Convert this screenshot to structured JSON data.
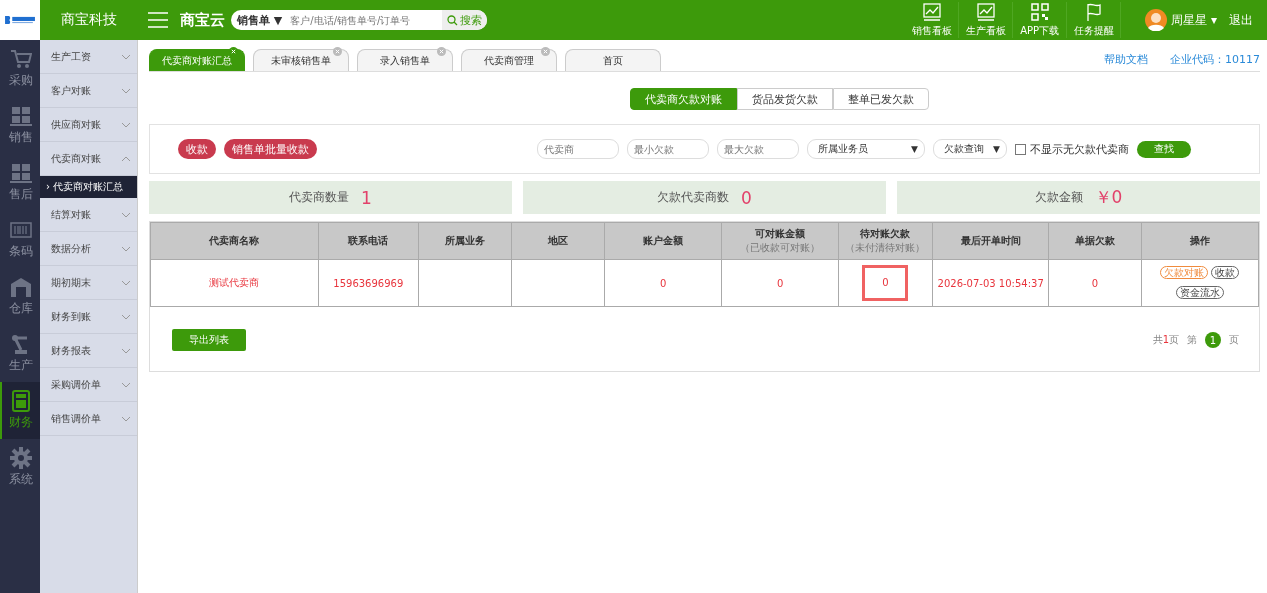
{
  "header": {
    "company": "商宝科技",
    "brand": "商宝云",
    "search": {
      "scope": "销售单 ▼",
      "placeholder": "客户/电话/销售单号/订单号",
      "button": "搜索"
    },
    "tools": [
      {
        "label": "销售看板",
        "kind": "chart"
      },
      {
        "label": "生产看板",
        "kind": "chart"
      },
      {
        "label": "APP下载",
        "kind": "qr"
      },
      {
        "label": "任务提醒",
        "kind": "flag"
      }
    ],
    "user": "周星星 ▾",
    "logout": "退出"
  },
  "rail": [
    {
      "label": "采购",
      "kind": "cart",
      "selected": false
    },
    {
      "label": "销售",
      "kind": "boxes",
      "selected": false
    },
    {
      "label": "售后",
      "kind": "boxes",
      "selected": false
    },
    {
      "label": "条码",
      "kind": "barcode",
      "selected": false
    },
    {
      "label": "仓库",
      "kind": "warehouse",
      "selected": false
    },
    {
      "label": "生产",
      "kind": "robot",
      "selected": false
    },
    {
      "label": "财务",
      "kind": "calculator",
      "selected": true
    },
    {
      "label": "系统",
      "kind": "gear",
      "selected": false
    }
  ],
  "menu": [
    {
      "label": "生产工资",
      "expanded": false
    },
    {
      "label": "客户对账",
      "expanded": false
    },
    {
      "label": "供应商对账",
      "expanded": false
    },
    {
      "label": "代卖商对账",
      "expanded": true,
      "children": [
        {
          "label": "› 代卖商对账汇总",
          "selected": true
        }
      ]
    },
    {
      "label": "结算对账",
      "expanded": false
    },
    {
      "label": "数据分析",
      "expanded": false
    },
    {
      "label": "期初期末",
      "expanded": false
    },
    {
      "label": "财务到账",
      "expanded": false
    },
    {
      "label": "财务报表",
      "expanded": false
    },
    {
      "label": "采购调价单",
      "expanded": false
    },
    {
      "label": "销售调价单",
      "expanded": false
    }
  ],
  "tabs": [
    {
      "label": "代卖商对账汇总",
      "selected": true,
      "closable": true
    },
    {
      "label": "未审核销售单",
      "selected": false,
      "closable": true
    },
    {
      "label": "录入销售单",
      "selected": false,
      "closable": true
    },
    {
      "label": "代卖商管理",
      "selected": false,
      "closable": true
    },
    {
      "label": "首页",
      "selected": false,
      "closable": false
    }
  ],
  "help_link": "帮助文档",
  "company_code": "企业代码：10117",
  "subtabs": [
    {
      "label": "代卖商欠款对账",
      "selected": true
    },
    {
      "label": "货品发货欠款",
      "selected": false
    },
    {
      "label": "整单已发欠款",
      "selected": false
    }
  ],
  "filters": {
    "buttons": [
      "收款",
      "销售单批量收款"
    ],
    "inputs": [
      {
        "placeholder": "代卖商"
      },
      {
        "placeholder": "最小欠款"
      },
      {
        "placeholder": "最大欠款"
      }
    ],
    "selects": [
      {
        "label": "所属业务员",
        "caret": "▼"
      },
      {
        "label": "欠款查询",
        "caret": "▼"
      }
    ],
    "checkbox": {
      "label": "不显示无欠款代卖商",
      "checked": false
    },
    "find": "查找"
  },
  "stats": [
    {
      "label": "代卖商数量",
      "value": "1"
    },
    {
      "label": "欠款代卖商数",
      "value": "0"
    },
    {
      "label": "欠款金额",
      "value": "￥0"
    }
  ],
  "table": {
    "columns": [
      {
        "label": "代卖商名称"
      },
      {
        "label": "联系电话"
      },
      {
        "label": "所属业务"
      },
      {
        "label": "地区"
      },
      {
        "label": "账户金额"
      },
      {
        "label": "可对账金额",
        "note": "（已收款可对账）"
      },
      {
        "label": "待对账欠款",
        "note": "（未付清待对账）"
      },
      {
        "label": "最后开单时间"
      },
      {
        "label": "单据欠款"
      },
      {
        "label": "操作"
      }
    ],
    "rows": [
      {
        "cells": [
          {
            "text": "测试代卖商",
            "highlighted": false
          },
          {
            "text": "15963696969",
            "highlighted": false
          },
          {
            "text": "",
            "highlighted": false
          },
          {
            "text": "",
            "highlighted": false
          },
          {
            "text": "0",
            "highlighted": false
          },
          {
            "text": "0",
            "highlighted": false
          },
          {
            "text": "0",
            "highlighted": true
          },
          {
            "text": "2026-07-03 10:54:37",
            "highlighted": false
          },
          {
            "text": "0",
            "highlighted": false
          }
        ],
        "actions": [
          {
            "label": "欠款对账",
            "kind": "primary"
          },
          {
            "label": "收款",
            "kind": "plain"
          },
          {
            "label": "资金流水",
            "kind": "plain"
          }
        ]
      }
    ]
  },
  "export": "导出列表",
  "pager": {
    "total_prefix": "共",
    "total": "1",
    "total_suffix": "页",
    "page_prefix": "第",
    "pages": [
      {
        "label": "1",
        "selected": true
      }
    ],
    "page_suffix": "页"
  }
}
